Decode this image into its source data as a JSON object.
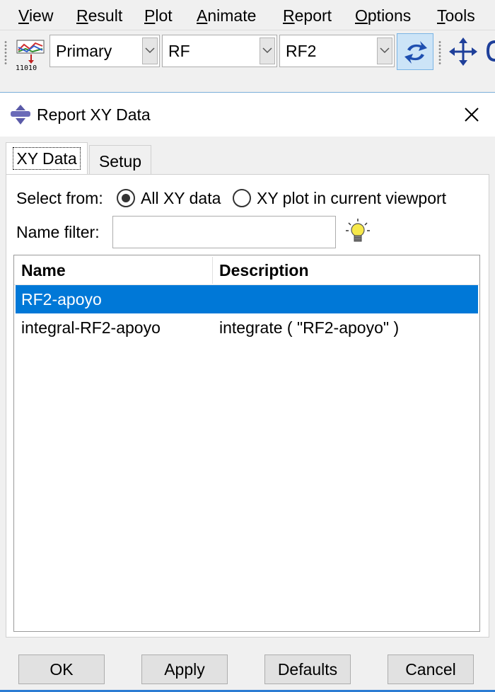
{
  "menubar": {
    "items": [
      {
        "label": "View",
        "mnemonic": "V",
        "rest": "iew"
      },
      {
        "label": "Result",
        "mnemonic": "R",
        "rest": "esult"
      },
      {
        "label": "Plot",
        "mnemonic": "P",
        "rest": "lot"
      },
      {
        "label": "Animate",
        "mnemonic": "A",
        "rest": "nimate"
      },
      {
        "label": "Report",
        "mnemonic": "R",
        "rest": "eport"
      },
      {
        "label": "Options",
        "mnemonic": "O",
        "rest": "ptions"
      },
      {
        "label": "Tools",
        "mnemonic": "T",
        "rest": "ools"
      }
    ]
  },
  "toolbar": {
    "plot_icon_text": "11010",
    "combo_step": "Primary",
    "combo_variable": "RF",
    "combo_component": "RF2"
  },
  "dialog": {
    "title": "Report XY Data",
    "tabs": [
      {
        "label": "XY Data",
        "active": true
      },
      {
        "label": "Setup",
        "active": false
      }
    ],
    "select_from_label": "Select from:",
    "radio_all": {
      "label": "All XY data",
      "checked": true
    },
    "radio_plot": {
      "label": "XY plot in current viewport",
      "checked": false
    },
    "name_filter_label": "Name filter:",
    "name_filter_value": "",
    "table": {
      "columns": [
        "Name",
        "Description"
      ],
      "rows": [
        {
          "name": "RF2-apoyo",
          "description": "",
          "selected": true
        },
        {
          "name": "integral-RF2-apoyo",
          "description": "integrate ( \"RF2-apoyo\" )",
          "selected": false
        }
      ]
    },
    "buttons": {
      "ok": "OK",
      "apply": "Apply",
      "defaults": "Defaults",
      "cancel": "Cancel"
    }
  },
  "colors": {
    "selection": "#0078d7",
    "accent_blue": "#2b7cd3",
    "sync_button_bg": "#cce4f7"
  },
  "icons": [
    "plot-options-icon",
    "sync-icon",
    "move-icon",
    "lightbulb-icon",
    "close-icon",
    "dialog-icon",
    "chevron-down-icon"
  ]
}
